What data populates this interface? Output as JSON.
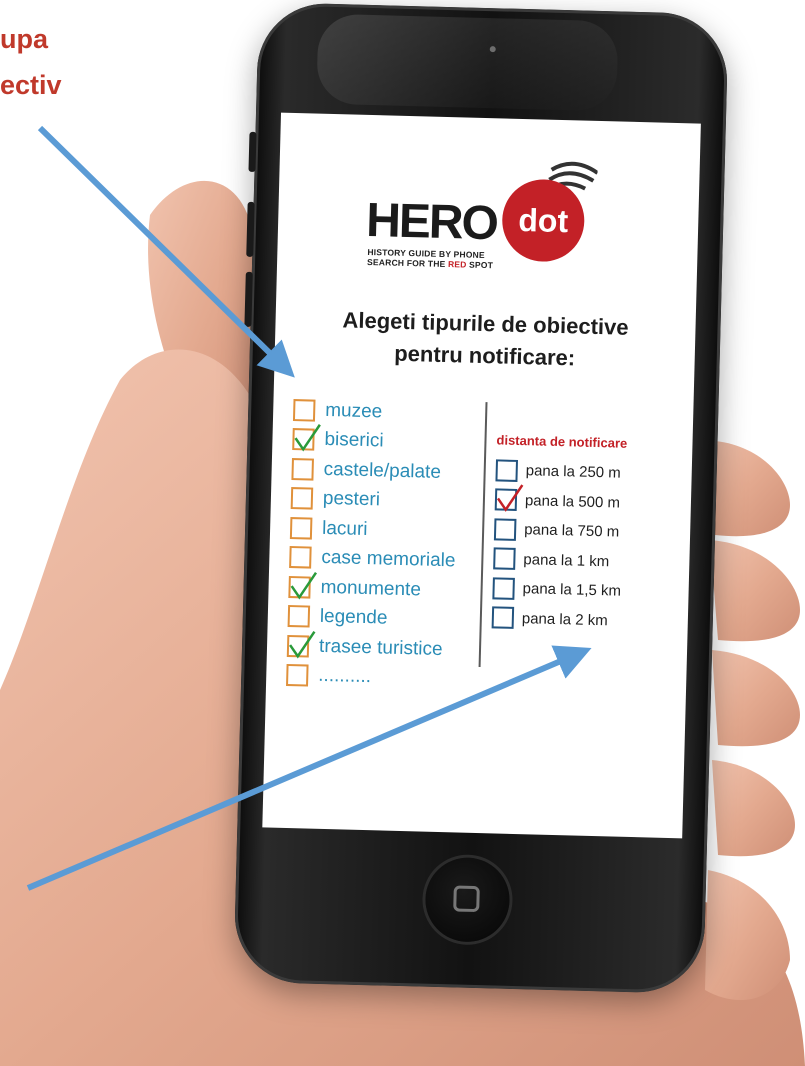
{
  "corner_caption": {
    "line1": "upa",
    "line2": "ectiv"
  },
  "logo": {
    "hero": "HERO",
    "dot": "dot",
    "tagline_line1": "HISTORY GUIDE BY PHONE",
    "tagline_line2_prefix": "SEARCH FOR THE ",
    "tagline_line2_red": "RED",
    "tagline_line2_suffix": " SPOT"
  },
  "screen": {
    "title_line1": "Alegeti tipurile de obiective",
    "title_line2": "pentru notificare:"
  },
  "objective_types": [
    {
      "label": "muzee",
      "checked": false
    },
    {
      "label": "biserici",
      "checked": true
    },
    {
      "label": "castele/palate",
      "checked": false
    },
    {
      "label": "pesteri",
      "checked": false
    },
    {
      "label": "lacuri",
      "checked": false
    },
    {
      "label": "case memoriale",
      "checked": false
    },
    {
      "label": "monumente",
      "checked": true
    },
    {
      "label": "legende",
      "checked": false
    },
    {
      "label": "trasee turistice",
      "checked": true
    },
    {
      "label": "..........",
      "checked": false
    }
  ],
  "distance": {
    "title": "distanta de notificare",
    "options": [
      {
        "label": "pana la 250 m",
        "checked": false
      },
      {
        "label": "pana la 500 m",
        "checked": true
      },
      {
        "label": "pana la 750 m",
        "checked": false
      },
      {
        "label": "pana la 1 km",
        "checked": false
      },
      {
        "label": "pana la 1,5 km",
        "checked": false
      },
      {
        "label": "pana la 2 km",
        "checked": false
      }
    ]
  },
  "colors": {
    "accent_red": "#c32127",
    "label_teal": "#2a8cb6",
    "box_orange": "#e0913b",
    "box_blue": "#23537e",
    "check_green": "#2a9a3a",
    "arrow_blue": "#5b9bd5"
  }
}
